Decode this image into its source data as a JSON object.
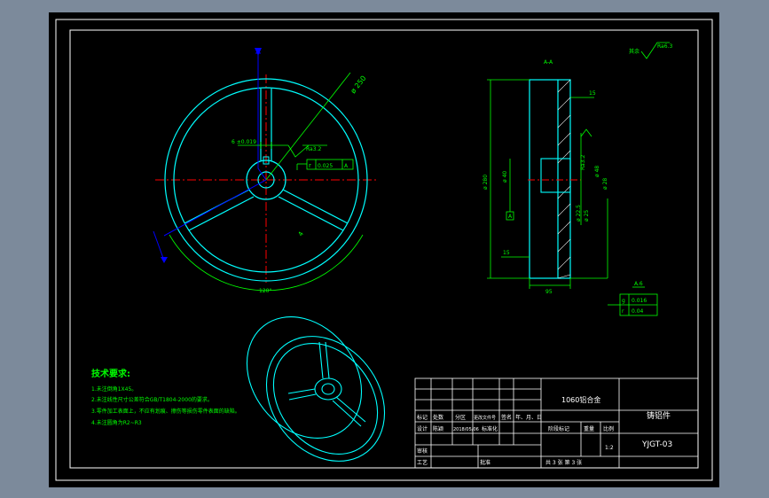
{
  "colors": {
    "bg_outer": "#7c8a9b",
    "paper": "#000000",
    "frame": "#ffffff",
    "geometry": "#00ffff",
    "dimension": "#00ff00",
    "centerline": "#ff0000",
    "axis": "#0000ff",
    "hatch": "#ffffff"
  },
  "drawing": {
    "dims": {
      "outer_diameter": "ø 250",
      "tolerance_width": "6 ±0.019",
      "roughness_a": "Ra3.2",
      "flatness_a": "0.025",
      "datum_letter": "A",
      "angle_spokes": "120°",
      "spoke_label": "4",
      "view_label": "A-A",
      "top_right_label": "其余",
      "roughness_top": "Ra6.3",
      "dim_top": "15",
      "diameter_left": "ø 280",
      "diameter_hub": "ø 40",
      "diameter_center": "ø 18",
      "bottom_15": "15",
      "width_bottom": "95",
      "right_roughness": "Ra3.2",
      "right_dim_1": "ø 22.5",
      "right_dim_2": "ø 25",
      "right_dim_3": "ø 48",
      "right_dim_4": "ø 28",
      "tol_label": "A.6",
      "tol_g": "g",
      "tol_g_val": "0.016",
      "tol_r": "r",
      "tol_r_val": "0.04"
    },
    "notes": {
      "title": "技术要求:",
      "items": [
        "1.未注倒角1X45。",
        "2.未注线性尺寸公差符合GB/T1804-2000的要求。",
        "3.零件加工表面上，不应有划痕、擦伤等损伤零件表面的缺陷。",
        "4.未注圆角为R2~R3"
      ]
    },
    "title_block": {
      "material": "1060铝合金",
      "part_name": "铸铝件",
      "drawing_no": "YJGT-03",
      "scale": "1:2",
      "sheet": "共 3 张  第 3 张",
      "row_labels": [
        "标记",
        "处数",
        "分区",
        "更改文件号",
        "签名",
        "年、月、日"
      ],
      "design_row": [
        "设计",
        "陈颖",
        "2018/05/06",
        "标准化"
      ],
      "check": "审核",
      "process": "工艺",
      "approve": "批准",
      "stage_mark": "阶段标记",
      "weight": "重量",
      "ratio": "比例"
    }
  }
}
